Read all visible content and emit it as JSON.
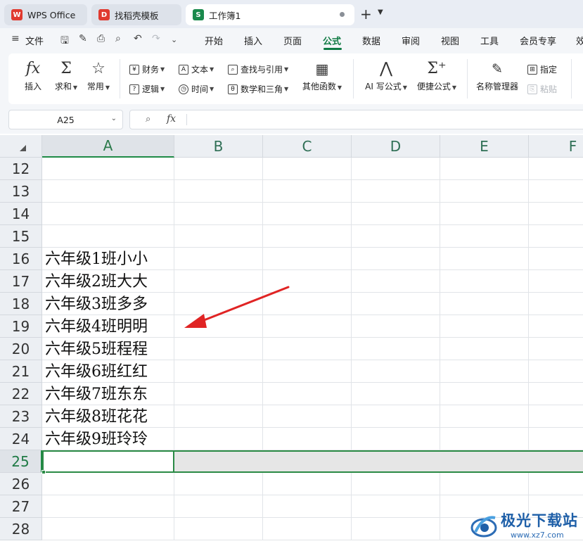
{
  "tabs": [
    {
      "label": "WPS Office",
      "icon": "wps-logo-icon",
      "color": "#e03a2f"
    },
    {
      "label": "找稻壳模板",
      "icon": "docer-icon",
      "color": "#e03a2f"
    },
    {
      "label": "工作簿1",
      "icon": "spreadsheet-icon",
      "color": "#1a8a4d"
    }
  ],
  "menu": {
    "file": "文件",
    "items": [
      "开始",
      "插入",
      "页面",
      "公式",
      "数据",
      "审阅",
      "视图",
      "工具",
      "会员专享",
      "效"
    ],
    "active": "公式"
  },
  "ribbon": {
    "insert_function": "插入",
    "autosum": "求和",
    "common": "常用",
    "finance": "财务",
    "text": "文本",
    "lookup": "查找与引用",
    "logic": "逻辑",
    "time": "时间",
    "math": "数学和三角",
    "other": "其他函数",
    "ai_formula": "AI 写公式",
    "quick_formula": "便捷公式",
    "name_manager": "名称管理器",
    "specify": "指定",
    "paste": "粘贴"
  },
  "formula_bar": {
    "name_box": "A25",
    "fx": "fx",
    "value": ""
  },
  "grid": {
    "columns": [
      "A",
      "B",
      "C",
      "D",
      "E",
      "F"
    ],
    "selected_column": "A",
    "rows": [
      {
        "num": "12",
        "a": ""
      },
      {
        "num": "13",
        "a": ""
      },
      {
        "num": "14",
        "a": ""
      },
      {
        "num": "15",
        "a": ""
      },
      {
        "num": "16",
        "a": "六年级1班小小"
      },
      {
        "num": "17",
        "a": "六年级2班大大"
      },
      {
        "num": "18",
        "a": "六年级3班多多"
      },
      {
        "num": "19",
        "a": "六年级4班明明"
      },
      {
        "num": "20",
        "a": "六年级5班程程"
      },
      {
        "num": "21",
        "a": "六年级6班红红"
      },
      {
        "num": "22",
        "a": "六年级7班东东"
      },
      {
        "num": "23",
        "a": "六年级8班花花"
      },
      {
        "num": "24",
        "a": "六年级9班玲玲"
      },
      {
        "num": "25",
        "a": ""
      },
      {
        "num": "26",
        "a": ""
      },
      {
        "num": "27",
        "a": ""
      },
      {
        "num": "28",
        "a": ""
      }
    ],
    "selected_row": "25"
  },
  "watermark": {
    "name": "极光下载站",
    "url": "www.xz7.com"
  },
  "colors": {
    "accent": "#1f8a46",
    "arrow": "#e02424"
  }
}
